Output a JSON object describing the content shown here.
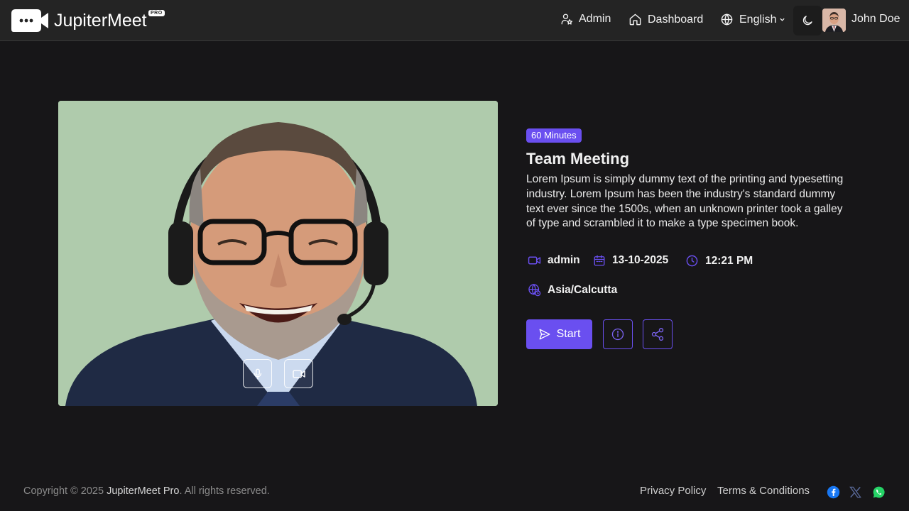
{
  "header": {
    "app_name": "JupiterMeet",
    "pro_label": "PRO",
    "nav": {
      "admin": "Admin",
      "dashboard": "Dashboard",
      "language": "English"
    },
    "user": {
      "name": "John Doe"
    },
    "icons": [
      "chat-bubble-logo-icon",
      "user-star-icon",
      "home-icon",
      "globe-icon",
      "chevron-down-icon",
      "moon-icon"
    ]
  },
  "meeting": {
    "duration_badge": "60 Minutes",
    "title": "Team Meeting",
    "description": "Lorem Ipsum is simply dummy text of the printing and typesetting industry. Lorem Ipsum has been the industry's standard dummy text ever since the 1500s, when an unknown printer took a galley of type and scrambled it to make a type specimen book.",
    "host": "admin",
    "date": "13-10-2025",
    "time": "12:21 PM",
    "timezone": "Asia/Calcutta",
    "start_label": "Start"
  },
  "footer": {
    "copyright_prefix": "Copyright © 2025 ",
    "copyright_brand": "JupiterMeet Pro",
    "copyright_suffix": ". All rights reserved.",
    "privacy": "Privacy Policy",
    "terms": "Terms & Conditions",
    "social": [
      "facebook-icon",
      "x-icon",
      "whatsapp-icon"
    ]
  },
  "colors": {
    "background": "#171618",
    "header": "#242424",
    "accent": "#6a4ff0",
    "preview_backdrop": "#acc8a9"
  }
}
